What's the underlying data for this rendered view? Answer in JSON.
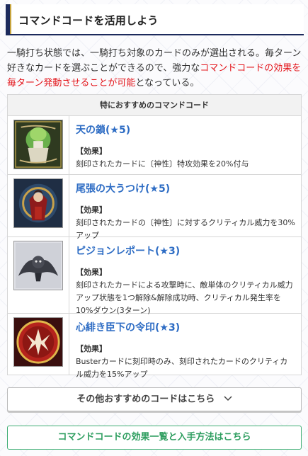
{
  "section": {
    "title": "コマンドコードを活用しよう"
  },
  "intro": {
    "text_before": "一騎打ち状態では、一騎打ち対象のカードのみが選出される。毎ターン好きなカードを選ぶことができるので、強力な",
    "highlight": "コマンドコードの効果を毎ターン発動させることが可能",
    "text_after": "となっている。"
  },
  "table": {
    "header": "特におすすめのコマンドコード",
    "rows": [
      {
        "name": "天の鎖(★5)",
        "effect_label": "【効果】",
        "effect": "刻印されたカードに〔神性〕特攻効果を20%付与",
        "icon": "chain-of-heaven-art"
      },
      {
        "name": "尾張の大うつけ(★5)",
        "effect_label": "【効果】",
        "effect": "刻印されたカードの〔神性〕に対するクリティカル威力を30%アップ",
        "icon": "owari-fool-art"
      },
      {
        "name": "ピジョンレポート(★3)",
        "effect_label": "【効果】",
        "effect": "刻印されたカードによる攻撃時に、敵単体のクリティカル威力アップ状態を1つ解除&解除成功時、クリティカル発生率を10%ダウン(3ターン)",
        "icon": "pigeon-report-art"
      },
      {
        "name": "心緋き臣下の令印(★3)",
        "effect_label": "【効果】",
        "effect": "Busterカードに刻印時のみ、刻印されたカードのクリティカル威力を15%アップ",
        "icon": "crimson-vassal-seal-art"
      }
    ]
  },
  "buttons": {
    "more_label": "その他おすすめのコードはこちら",
    "link_label": "コマンドコードの効果一覧と入手方法はこちら"
  },
  "colors": {
    "accent_navy": "#1c2a5c",
    "accent_gold": "#c7a43d",
    "highlight_red": "#e3141a",
    "link_blue": "#2d6cc4",
    "link_green": "#2f9e60"
  }
}
